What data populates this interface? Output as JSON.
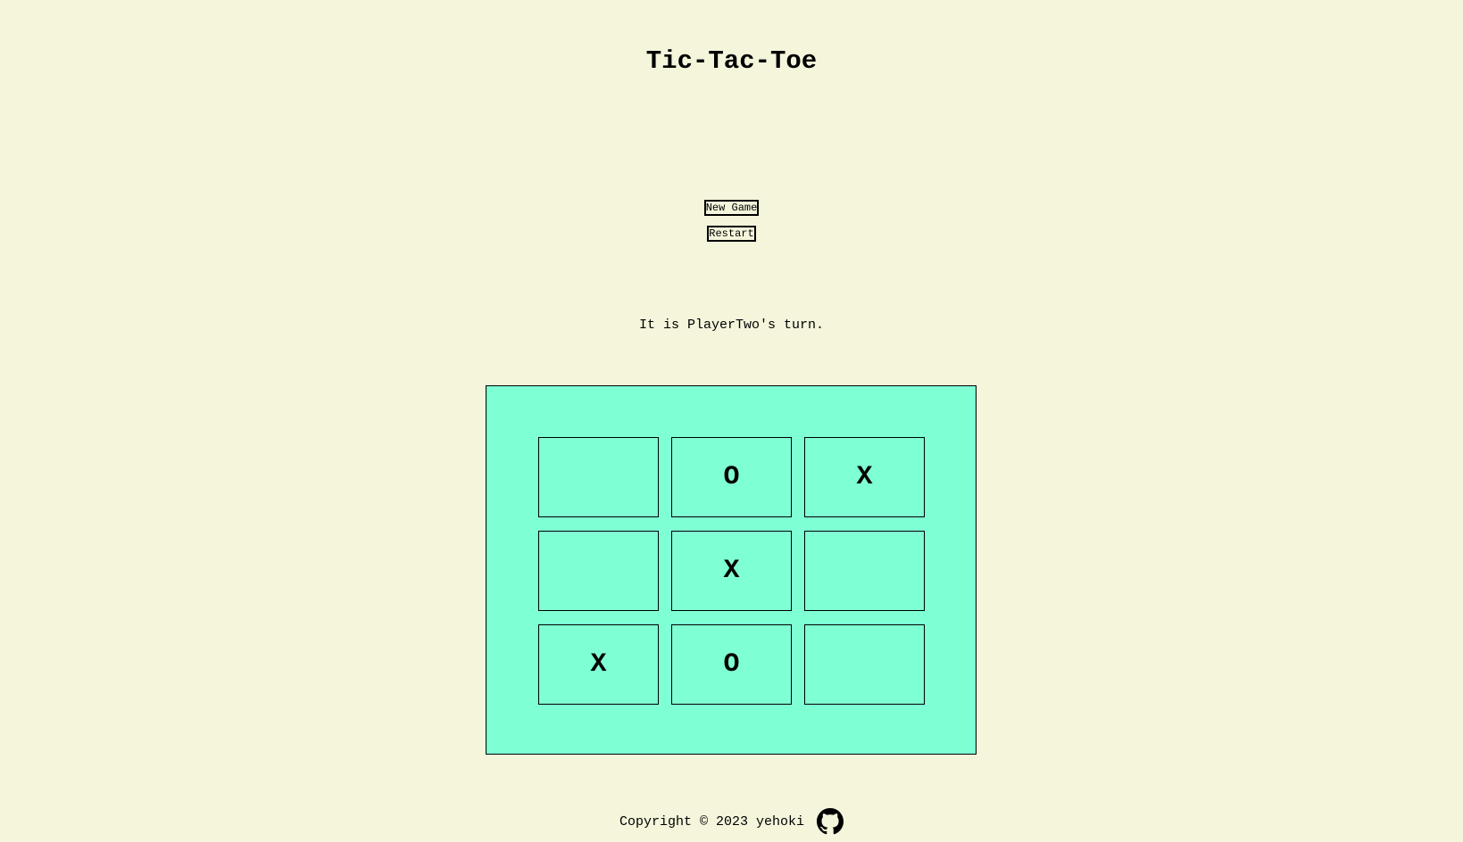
{
  "header": {
    "title": "Tic-Tac-Toe"
  },
  "controls": {
    "new_game_label": "New Game",
    "restart_label": "Restart"
  },
  "status": {
    "text": "It is PlayerTwo's turn."
  },
  "board": {
    "cells": [
      "",
      "O",
      "X",
      "",
      "X",
      "",
      "X",
      "O",
      ""
    ]
  },
  "footer": {
    "copyright": "Copyright © 2023 yehoki",
    "icon": "github-icon"
  },
  "colors": {
    "background": "#f5f5dc",
    "board": "#7fffd4"
  }
}
